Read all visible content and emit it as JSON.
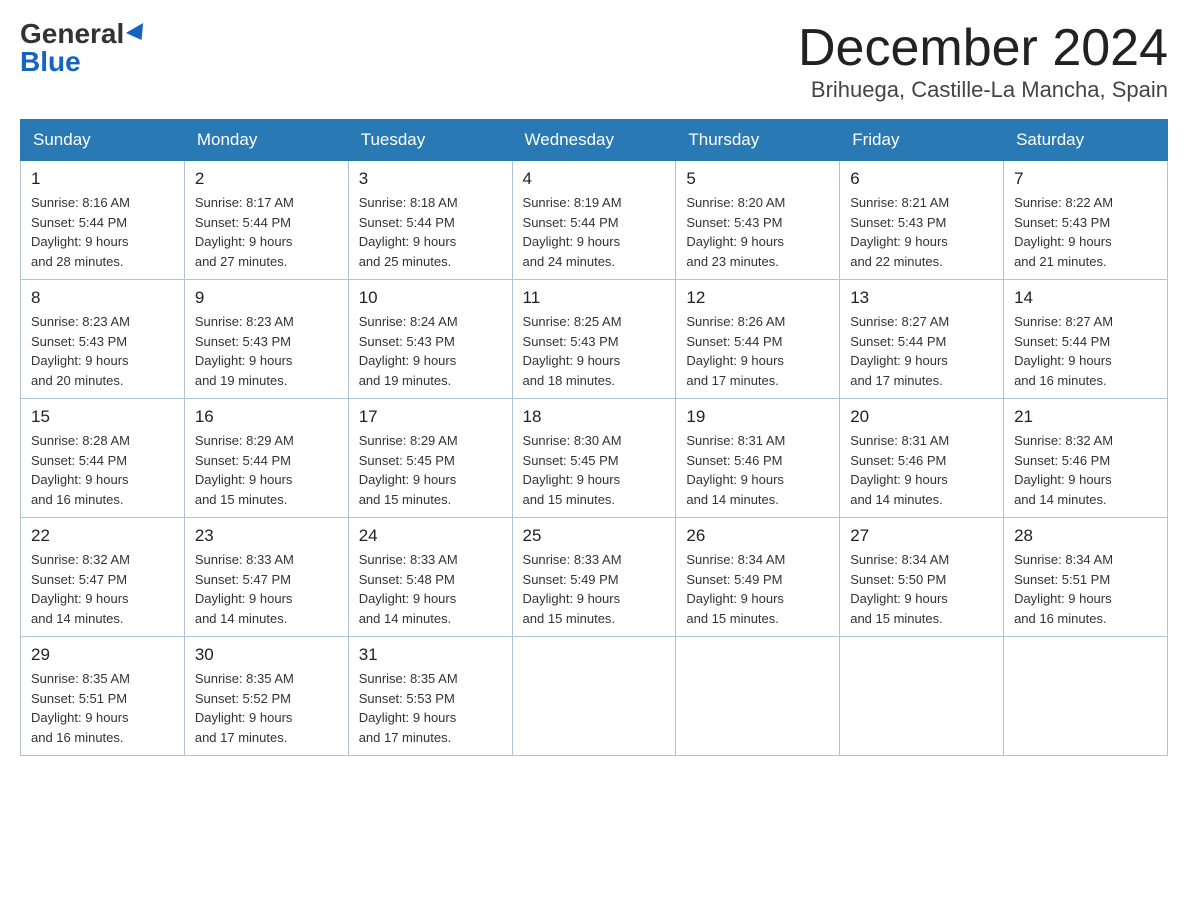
{
  "logo": {
    "general": "General",
    "blue": "Blue"
  },
  "header": {
    "month": "December 2024",
    "location": "Brihuega, Castille-La Mancha, Spain"
  },
  "weekdays": [
    "Sunday",
    "Monday",
    "Tuesday",
    "Wednesday",
    "Thursday",
    "Friday",
    "Saturday"
  ],
  "weeks": [
    [
      {
        "day": "1",
        "sunrise": "8:16 AM",
        "sunset": "5:44 PM",
        "daylight": "9 hours and 28 minutes."
      },
      {
        "day": "2",
        "sunrise": "8:17 AM",
        "sunset": "5:44 PM",
        "daylight": "9 hours and 27 minutes."
      },
      {
        "day": "3",
        "sunrise": "8:18 AM",
        "sunset": "5:44 PM",
        "daylight": "9 hours and 25 minutes."
      },
      {
        "day": "4",
        "sunrise": "8:19 AM",
        "sunset": "5:44 PM",
        "daylight": "9 hours and 24 minutes."
      },
      {
        "day": "5",
        "sunrise": "8:20 AM",
        "sunset": "5:43 PM",
        "daylight": "9 hours and 23 minutes."
      },
      {
        "day": "6",
        "sunrise": "8:21 AM",
        "sunset": "5:43 PM",
        "daylight": "9 hours and 22 minutes."
      },
      {
        "day": "7",
        "sunrise": "8:22 AM",
        "sunset": "5:43 PM",
        "daylight": "9 hours and 21 minutes."
      }
    ],
    [
      {
        "day": "8",
        "sunrise": "8:23 AM",
        "sunset": "5:43 PM",
        "daylight": "9 hours and 20 minutes."
      },
      {
        "day": "9",
        "sunrise": "8:23 AM",
        "sunset": "5:43 PM",
        "daylight": "9 hours and 19 minutes."
      },
      {
        "day": "10",
        "sunrise": "8:24 AM",
        "sunset": "5:43 PM",
        "daylight": "9 hours and 19 minutes."
      },
      {
        "day": "11",
        "sunrise": "8:25 AM",
        "sunset": "5:43 PM",
        "daylight": "9 hours and 18 minutes."
      },
      {
        "day": "12",
        "sunrise": "8:26 AM",
        "sunset": "5:44 PM",
        "daylight": "9 hours and 17 minutes."
      },
      {
        "day": "13",
        "sunrise": "8:27 AM",
        "sunset": "5:44 PM",
        "daylight": "9 hours and 17 minutes."
      },
      {
        "day": "14",
        "sunrise": "8:27 AM",
        "sunset": "5:44 PM",
        "daylight": "9 hours and 16 minutes."
      }
    ],
    [
      {
        "day": "15",
        "sunrise": "8:28 AM",
        "sunset": "5:44 PM",
        "daylight": "9 hours and 16 minutes."
      },
      {
        "day": "16",
        "sunrise": "8:29 AM",
        "sunset": "5:44 PM",
        "daylight": "9 hours and 15 minutes."
      },
      {
        "day": "17",
        "sunrise": "8:29 AM",
        "sunset": "5:45 PM",
        "daylight": "9 hours and 15 minutes."
      },
      {
        "day": "18",
        "sunrise": "8:30 AM",
        "sunset": "5:45 PM",
        "daylight": "9 hours and 15 minutes."
      },
      {
        "day": "19",
        "sunrise": "8:31 AM",
        "sunset": "5:46 PM",
        "daylight": "9 hours and 14 minutes."
      },
      {
        "day": "20",
        "sunrise": "8:31 AM",
        "sunset": "5:46 PM",
        "daylight": "9 hours and 14 minutes."
      },
      {
        "day": "21",
        "sunrise": "8:32 AM",
        "sunset": "5:46 PM",
        "daylight": "9 hours and 14 minutes."
      }
    ],
    [
      {
        "day": "22",
        "sunrise": "8:32 AM",
        "sunset": "5:47 PM",
        "daylight": "9 hours and 14 minutes."
      },
      {
        "day": "23",
        "sunrise": "8:33 AM",
        "sunset": "5:47 PM",
        "daylight": "9 hours and 14 minutes."
      },
      {
        "day": "24",
        "sunrise": "8:33 AM",
        "sunset": "5:48 PM",
        "daylight": "9 hours and 14 minutes."
      },
      {
        "day": "25",
        "sunrise": "8:33 AM",
        "sunset": "5:49 PM",
        "daylight": "9 hours and 15 minutes."
      },
      {
        "day": "26",
        "sunrise": "8:34 AM",
        "sunset": "5:49 PM",
        "daylight": "9 hours and 15 minutes."
      },
      {
        "day": "27",
        "sunrise": "8:34 AM",
        "sunset": "5:50 PM",
        "daylight": "9 hours and 15 minutes."
      },
      {
        "day": "28",
        "sunrise": "8:34 AM",
        "sunset": "5:51 PM",
        "daylight": "9 hours and 16 minutes."
      }
    ],
    [
      {
        "day": "29",
        "sunrise": "8:35 AM",
        "sunset": "5:51 PM",
        "daylight": "9 hours and 16 minutes."
      },
      {
        "day": "30",
        "sunrise": "8:35 AM",
        "sunset": "5:52 PM",
        "daylight": "9 hours and 17 minutes."
      },
      {
        "day": "31",
        "sunrise": "8:35 AM",
        "sunset": "5:53 PM",
        "daylight": "9 hours and 17 minutes."
      },
      null,
      null,
      null,
      null
    ]
  ],
  "labels": {
    "sunrise": "Sunrise:",
    "sunset": "Sunset:",
    "daylight": "Daylight:"
  }
}
